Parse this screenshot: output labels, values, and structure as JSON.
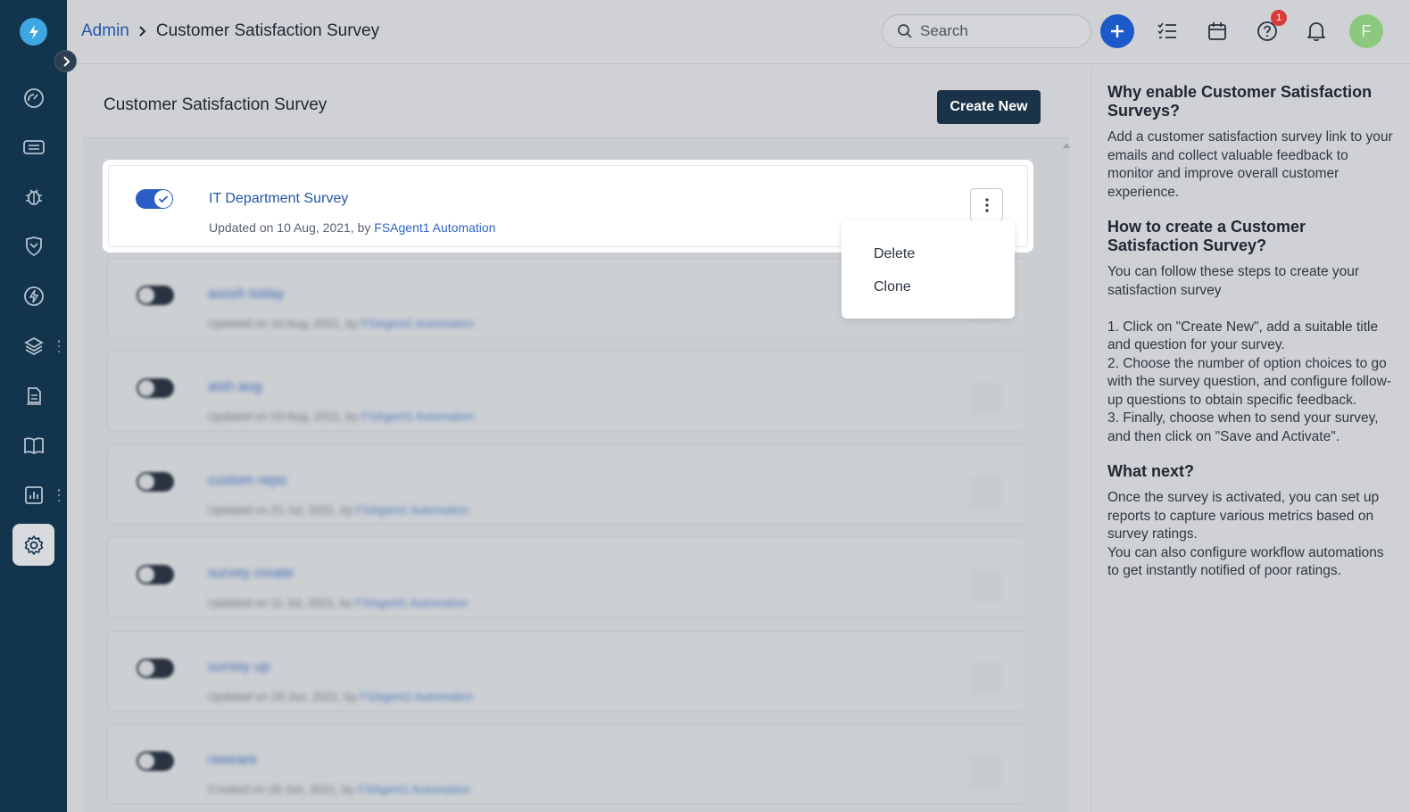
{
  "breadcrumb": {
    "root": "Admin",
    "current": "Customer Satisfaction Survey"
  },
  "search": {
    "placeholder": "Search"
  },
  "header": {
    "help_badge": "1",
    "avatar_initial": "F"
  },
  "main": {
    "title": "Customer Satisfaction Survey",
    "create_label": "Create New"
  },
  "surveys": [
    {
      "title": "IT Department Survey",
      "meta_prefix": "Updated on 10 Aug, 2021, by ",
      "agent": "FSAgent1 Automation",
      "enabled": true
    },
    {
      "title": "asssh today",
      "meta_prefix": "Updated on 10 Aug, 2021, by ",
      "agent": "FSAgent1 Automation",
      "enabled": false
    },
    {
      "title": "aish aug",
      "meta_prefix": "Updated on 03 Aug, 2021, by ",
      "agent": "FSAgent1 Automation",
      "enabled": false
    },
    {
      "title": "custom repo",
      "meta_prefix": "Updated on 21 Jul, 2021, by ",
      "agent": "FSAgent1 Automation",
      "enabled": false
    },
    {
      "title": "survey create",
      "meta_prefix": "Updated on 11 Jul, 2021, by ",
      "agent": "FSAgent1 Automation",
      "enabled": false
    },
    {
      "title": "survey up",
      "meta_prefix": "Updated on 29 Jun, 2021, by ",
      "agent": "FSAgent1 Automation",
      "enabled": false
    },
    {
      "title": "reeeare",
      "meta_prefix": "Created on 28 Jun, 2021, by ",
      "agent": "FSAgent1 Automation",
      "enabled": false
    }
  ],
  "dropdown": {
    "delete_label": "Delete",
    "clone_label": "Clone"
  },
  "help": {
    "h1": "Why enable Customer Satisfaction Surveys?",
    "p1": "Add a customer satisfaction survey link to your emails and collect valuable feedback to monitor and improve overall customer experience.",
    "h2": "How to create a Customer Satisfaction Survey?",
    "p2": "You can follow these steps to create your satisfaction survey\n\n1. Click on \"Create New\", add a suitable title and question for your survey.\n2. Choose the number of option choices to go with the survey question, and configure follow-up questions to obtain specific feedback.\n3. Finally, choose when to send your survey, and then click on \"Save and Activate\".",
    "h3": "What next?",
    "p3": "Once the survey is activated, you can set up reports to capture various metrics based on survey ratings.\nYou can also configure workflow automations to get instantly notified of poor ratings."
  },
  "colors": {
    "sidebar": "#12344d",
    "accent": "#2356a8",
    "primary_button": "#1b3348",
    "toggle_on": "#2c5cc5",
    "badge": "#d93a3a"
  }
}
